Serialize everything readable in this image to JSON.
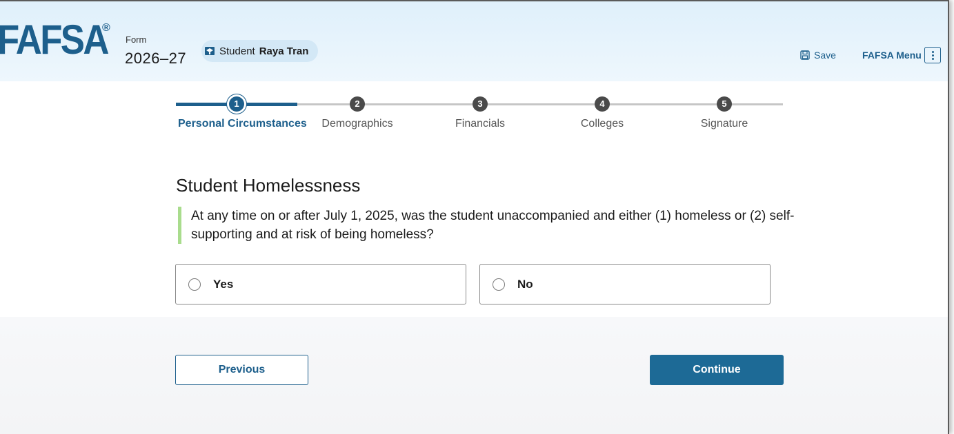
{
  "header": {
    "logo_text": "FAFSA",
    "logo_reg": "®",
    "form_label": "Form",
    "form_year": "2026–27",
    "student_prefix": "Student",
    "student_name": "Raya Tran",
    "save_label": "Save",
    "menu_label": "FAFSA Menu"
  },
  "progress": {
    "current_step": 1,
    "steps": [
      {
        "num": "1",
        "label": "Personal Circumstances"
      },
      {
        "num": "2",
        "label": "Demographics"
      },
      {
        "num": "3",
        "label": "Financials"
      },
      {
        "num": "4",
        "label": "Colleges"
      },
      {
        "num": "5",
        "label": "Signature"
      }
    ]
  },
  "main": {
    "title": "Student Homelessness",
    "question": "At any time on or after July 1, 2025, was the student unaccompanied and either (1) homeless or (2) self-supporting and at risk of being homeless?",
    "options": [
      {
        "label": "Yes",
        "selected": false
      },
      {
        "label": "No",
        "selected": false
      }
    ]
  },
  "footer": {
    "previous_label": "Previous",
    "continue_label": "Continue"
  },
  "colors": {
    "brand": "#1d5f8c",
    "continue_bg": "#1d6a96",
    "question_accent": "#a9dc8d"
  }
}
